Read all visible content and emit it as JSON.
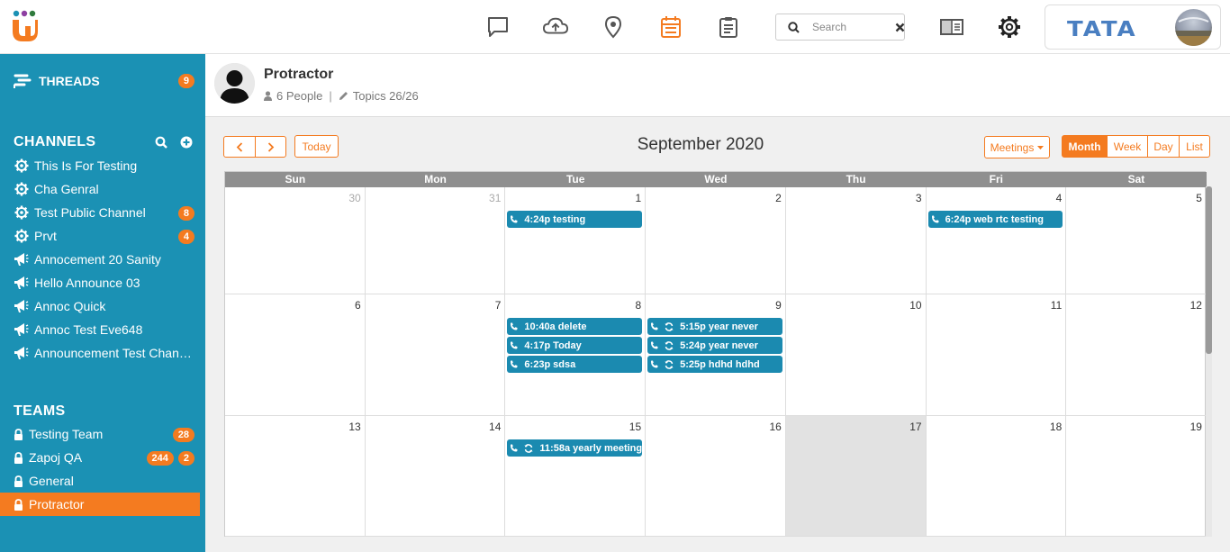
{
  "topbar": {
    "icons": [
      "chat-icon",
      "cloud-upload-icon",
      "location-pin-icon",
      "calendar-icon",
      "clipboard-icon"
    ],
    "search_placeholder": "Search",
    "brand": "TATA",
    "active_color": "#f47b20"
  },
  "sidebar": {
    "threads": {
      "label": "THREADS",
      "count": "9"
    },
    "channels_title": "CHANNELS",
    "channels": [
      {
        "label": "This Is For Testing",
        "icon": "gear-icon",
        "badge": ""
      },
      {
        "label": "Cha Genral",
        "icon": "gear-icon",
        "badge": ""
      },
      {
        "label": "Test Public Channel",
        "icon": "gear-icon",
        "badge": "8"
      },
      {
        "label": "Prvt",
        "icon": "gear-icon",
        "badge": "4"
      },
      {
        "label": "Annocement 20 Sanity",
        "icon": "megaphone-icon",
        "badge": ""
      },
      {
        "label": "Hello Announce 03",
        "icon": "megaphone-icon",
        "badge": ""
      },
      {
        "label": "Annoc Quick",
        "icon": "megaphone-icon",
        "badge": ""
      },
      {
        "label": "Annoc Test Eve648",
        "icon": "megaphone-icon",
        "badge": ""
      },
      {
        "label": "Announcement Test Channel",
        "icon": "megaphone-icon",
        "badge": ""
      }
    ],
    "teams_title": "TEAMS",
    "teams": [
      {
        "label": "Testing Team",
        "badges": [
          "28"
        ]
      },
      {
        "label": "Zapoj QA",
        "badges": [
          "244",
          "2"
        ]
      },
      {
        "label": "General",
        "badges": []
      },
      {
        "label": "Protractor",
        "badges": [],
        "active": true
      }
    ]
  },
  "header": {
    "title": "Protractor",
    "people": "6 People",
    "topics": "Topics 26/26"
  },
  "calendar": {
    "today_label": "Today",
    "title": "September 2020",
    "meetings_label": "Meetings",
    "views": [
      "Month",
      "Week",
      "Day",
      "List"
    ],
    "active_view": "Month",
    "days_of_week": [
      "Sun",
      "Mon",
      "Tue",
      "Wed",
      "Thu",
      "Fri",
      "Sat"
    ],
    "weeks": [
      [
        {
          "day": "30",
          "other": true,
          "events": []
        },
        {
          "day": "31",
          "other": true,
          "events": []
        },
        {
          "day": "1",
          "events": [
            {
              "time": "4:24p",
              "title": "testing",
              "recurring": false
            }
          ]
        },
        {
          "day": "2",
          "events": []
        },
        {
          "day": "3",
          "events": []
        },
        {
          "day": "4",
          "events": [
            {
              "time": "6:24p",
              "title": "web rtc testing",
              "recurring": false
            }
          ]
        },
        {
          "day": "5",
          "events": []
        }
      ],
      [
        {
          "day": "6",
          "events": []
        },
        {
          "day": "7",
          "events": []
        },
        {
          "day": "8",
          "events": [
            {
              "time": "10:40a",
              "title": "delete",
              "recurring": false
            },
            {
              "time": "4:17p",
              "title": "Today",
              "recurring": false
            },
            {
              "time": "6:23p",
              "title": "sdsa",
              "recurring": false
            }
          ]
        },
        {
          "day": "9",
          "events": [
            {
              "time": "5:15p",
              "title": "year never",
              "recurring": true
            },
            {
              "time": "5:24p",
              "title": "year never",
              "recurring": true
            },
            {
              "time": "5:25p",
              "title": "hdhd hdhd",
              "recurring": true
            }
          ]
        },
        {
          "day": "10",
          "events": []
        },
        {
          "day": "11",
          "events": []
        },
        {
          "day": "12",
          "events": []
        }
      ],
      [
        {
          "day": "13",
          "events": []
        },
        {
          "day": "14",
          "events": []
        },
        {
          "day": "15",
          "events": [
            {
              "time": "11:58a",
              "title": "yearly meeting",
              "recurring": true
            }
          ]
        },
        {
          "day": "16",
          "events": []
        },
        {
          "day": "17",
          "today": true,
          "events": []
        },
        {
          "day": "18",
          "events": []
        },
        {
          "day": "19",
          "events": []
        }
      ]
    ]
  }
}
